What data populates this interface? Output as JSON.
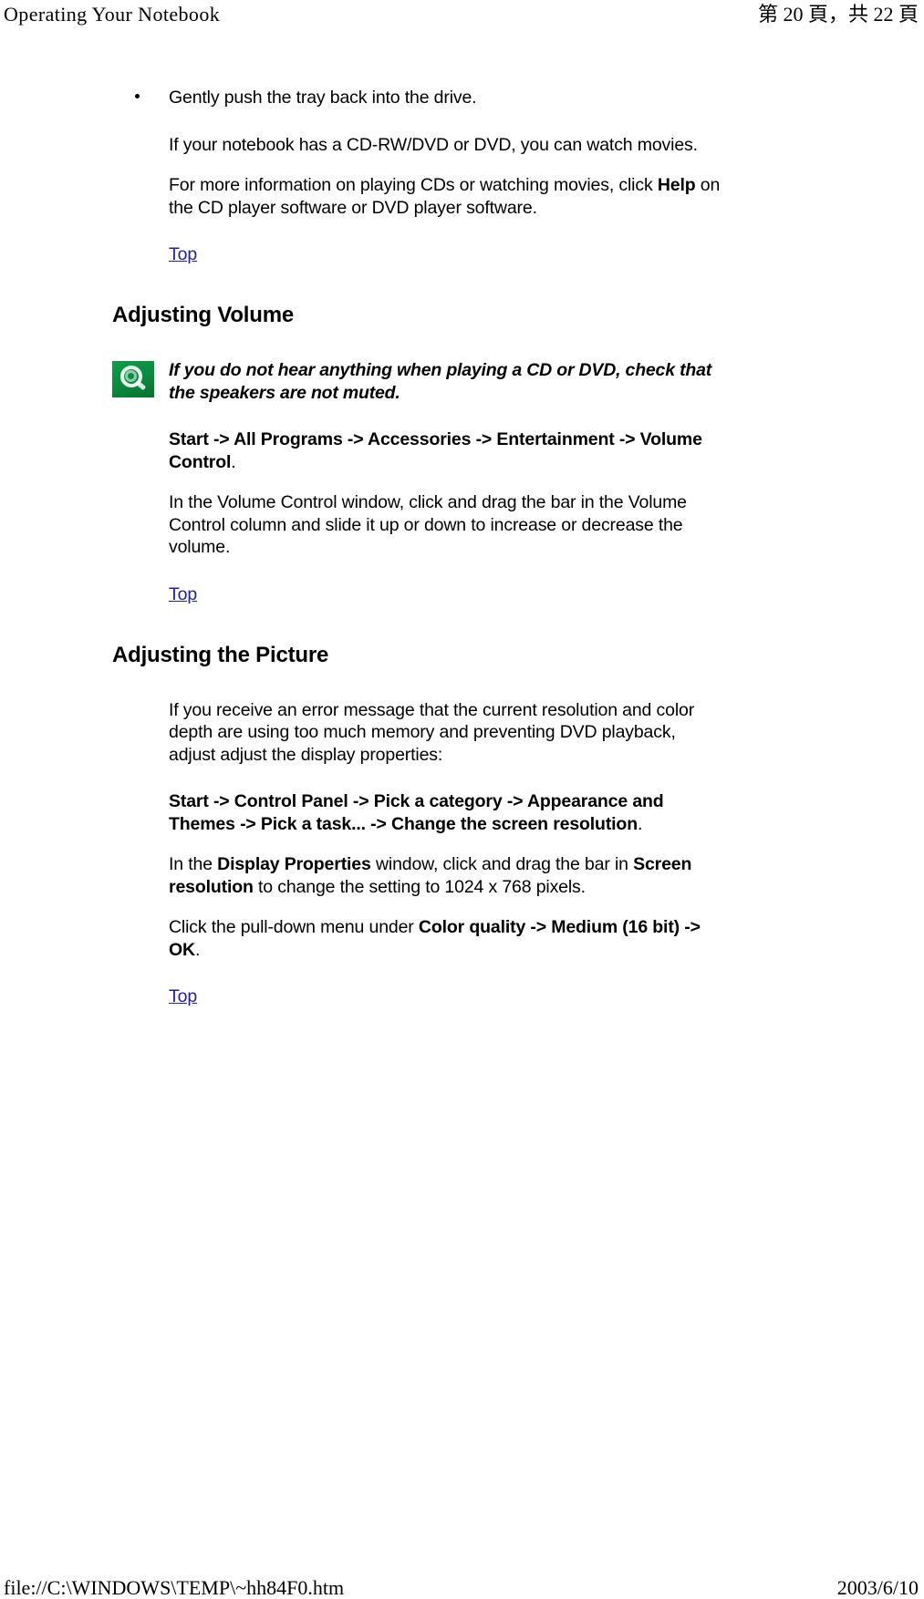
{
  "header": {
    "left_title": "Operating Your Notebook",
    "right_page_indicator": "第 20 頁，共 22 頁"
  },
  "content": {
    "bullet_item": "Gently push the tray back into the drive.",
    "paragraph_movies": "If your notebook has a CD-RW/DVD or DVD, you can watch movies.",
    "paragraph_more_info_pre": "For more information on playing CDs or watching movies, click ",
    "paragraph_more_info_bold": "Help",
    "paragraph_more_info_post": " on the CD player software or DVD player software.",
    "top_link_1": "Top",
    "heading_volume": "Adjusting Volume",
    "note_volume": "If you do not hear anything when playing a CD or DVD, check that the speakers are not muted.",
    "path_volume_bold": "Start -> All Programs -> Accessories -> Entertainment -> Volume Control",
    "path_volume_period": ".",
    "paragraph_volume_control": "In the Volume Control window, click and drag the bar in the Volume Control column and slide it up or down to increase or decrease the volume.",
    "top_link_2": "Top",
    "heading_picture": "Adjusting the Picture",
    "paragraph_error": "If you receive an error message that the current resolution and color depth are using too much memory and preventing DVD playback, adjust adjust the display properties:",
    "path_display_bold": "Start -> Control Panel -> Pick a category -> Appearance and Themes -> Pick a task... -> Change the screen resolution",
    "path_display_period": ".",
    "paragraph_display_pre": "In the ",
    "paragraph_display_bold1": "Display Properties",
    "paragraph_display_mid": " window, click and drag the bar in ",
    "paragraph_display_bold2": "Screen resolution",
    "paragraph_display_post": " to change the setting to 1024 x 768 pixels.",
    "paragraph_color_pre": "Click the pull-down menu under ",
    "paragraph_color_bold": "Color quality -> Medium (16 bit) -> OK",
    "paragraph_color_post": ".",
    "top_link_3": "Top"
  },
  "footer": {
    "file_path": "file://C:\\WINDOWS\\TEMP\\~hh84F0.htm",
    "date": "2003/6/10"
  },
  "colors": {
    "link": "#22229C",
    "note_icon_green": "#0A8A3F",
    "text": "#000000",
    "background": "#FFFFFF"
  }
}
